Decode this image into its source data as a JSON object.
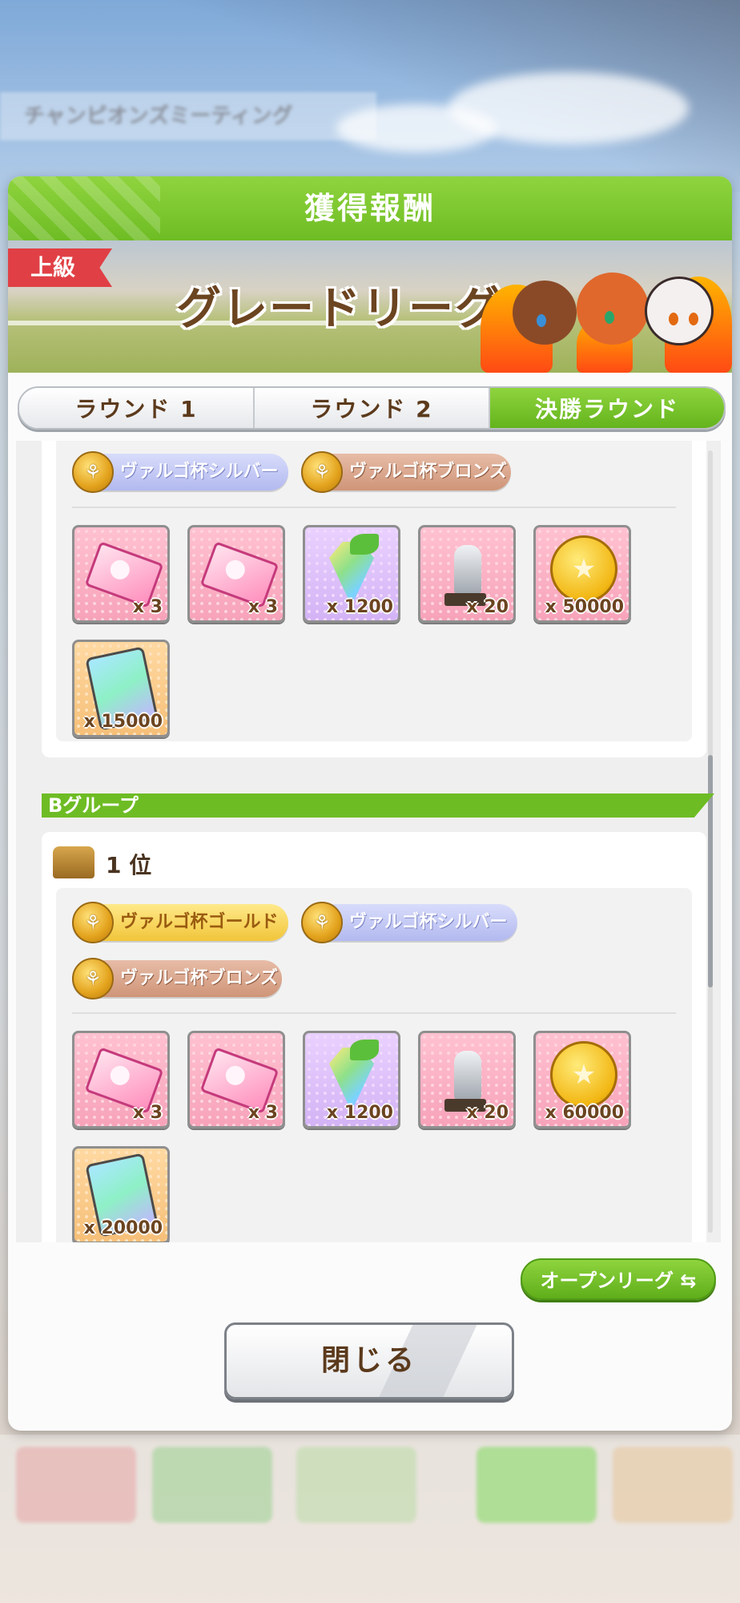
{
  "background": {
    "banner_text": "チャンピオンズミーティング"
  },
  "modal": {
    "title": "獲得報酬",
    "tier_badge": "上級",
    "league_title": "グレードリーグ"
  },
  "tabs": [
    {
      "label": "ラウンド 1",
      "active": false
    },
    {
      "label": "ラウンド 2",
      "active": false
    },
    {
      "label": "決勝ラウンド",
      "active": true
    }
  ],
  "group_a_partial": {
    "chips": [
      {
        "label": "ヴァルゴ杯シルバー",
        "tier": "silver"
      },
      {
        "label": "ヴァルゴ杯ブロンズ",
        "tier": "bronze"
      }
    ],
    "items": [
      {
        "icon": "ticket-icon",
        "qty": "x 3"
      },
      {
        "icon": "ticket-icon",
        "qty": "x 3"
      },
      {
        "icon": "crystal-carrot-icon",
        "qty": "x 1200"
      },
      {
        "icon": "horse-statue-icon",
        "qty": "x 20"
      },
      {
        "icon": "gold-coin-icon",
        "qty": "x 50000"
      },
      {
        "icon": "support-card-icon",
        "qty": "x 15000"
      }
    ]
  },
  "group_b": {
    "header": "Bグループ",
    "rank": "1 位",
    "chips": [
      {
        "label": "ヴァルゴ杯ゴールド",
        "tier": "gold"
      },
      {
        "label": "ヴァルゴ杯シルバー",
        "tier": "silver"
      },
      {
        "label": "ヴァルゴ杯ブロンズ",
        "tier": "bronze"
      }
    ],
    "items": [
      {
        "icon": "ticket-icon",
        "qty": "x 3"
      },
      {
        "icon": "ticket-icon",
        "qty": "x 3"
      },
      {
        "icon": "crystal-carrot-icon",
        "qty": "x 1200"
      },
      {
        "icon": "horse-statue-icon",
        "qty": "x 20"
      },
      {
        "icon": "gold-coin-icon",
        "qty": "x 60000"
      },
      {
        "icon": "support-card-icon",
        "qty": "x 20000"
      }
    ]
  },
  "buttons": {
    "open_league": "オープンリーグ ⇆",
    "close": "閉じる"
  },
  "colors": {
    "accent_green": "#6ebc24",
    "tier_red": "#e04045",
    "text_brown": "#5b3a1c"
  }
}
